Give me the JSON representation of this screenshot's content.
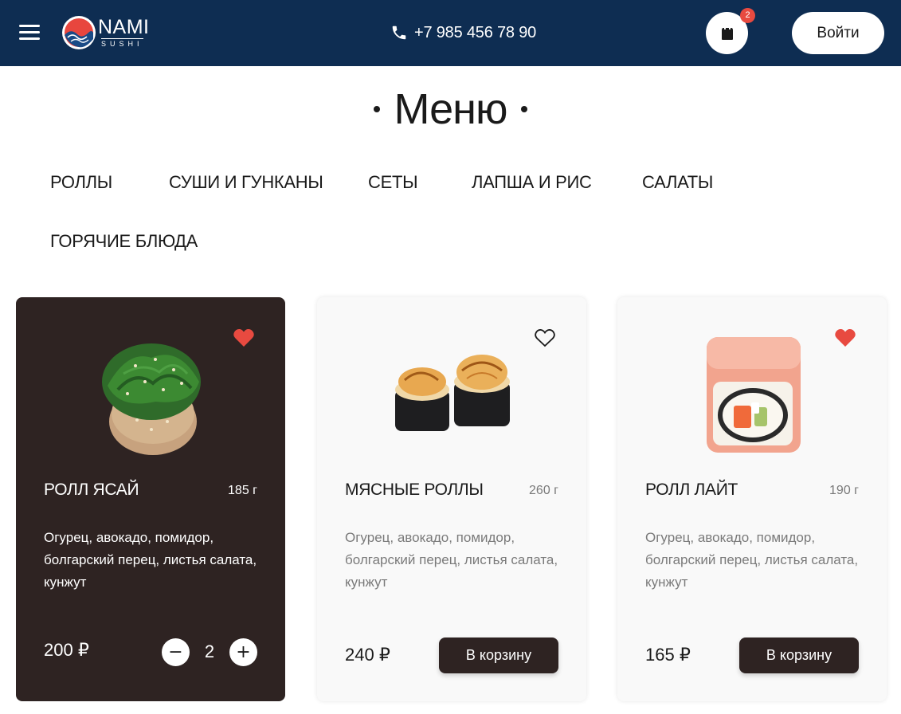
{
  "header": {
    "logo_word": "NAMI",
    "logo_sub": "SUSHI",
    "phone": "+7 985 456 78 90",
    "cart_count": "2",
    "login_label": "Войти"
  },
  "page": {
    "title": "Меню"
  },
  "categories": [
    {
      "label": "РОЛЛЫ"
    },
    {
      "label": "СУШИ И ГУНКАНЫ"
    },
    {
      "label": "СЕТЫ"
    },
    {
      "label": "ЛАПША И РИС"
    },
    {
      "label": "САЛАТЫ"
    },
    {
      "label": "ГОРЯЧИЕ БЛЮДА"
    }
  ],
  "products": [
    {
      "name": "РОЛЛ ЯСАЙ",
      "weight": "185 г",
      "description": "Огурец, авокадо, помидор, болгарский перец, листья салата, кунжут",
      "price": "200 ₽",
      "favorite": true,
      "in_cart": true,
      "quantity": "2",
      "minus_label": "−",
      "plus_label": "+"
    },
    {
      "name": "МЯСНЫЕ РОЛЛЫ",
      "weight": "260 г",
      "description": "Огурец, авокадо, помидор, болгарский перец, листья салата, кунжут",
      "price": "240 ₽",
      "favorite": false,
      "in_cart": false,
      "add_label": "В корзину"
    },
    {
      "name": "РОЛЛ ЛАЙТ",
      "weight": "190 г",
      "description": "Огурец, авокадо, помидор, болгарский перец, листья салата, кунжут",
      "price": "165 ₽",
      "favorite": true,
      "in_cart": false,
      "add_label": "В корзину"
    }
  ],
  "colors": {
    "header_bg": "#0e2d52",
    "accent_dark": "#2e2322",
    "favorite_red": "#e84a40"
  },
  "icons": {
    "menu": "hamburger-icon",
    "phone": "phone-icon",
    "cart": "shopping-bag-icon",
    "favorite": "heart-icon"
  }
}
